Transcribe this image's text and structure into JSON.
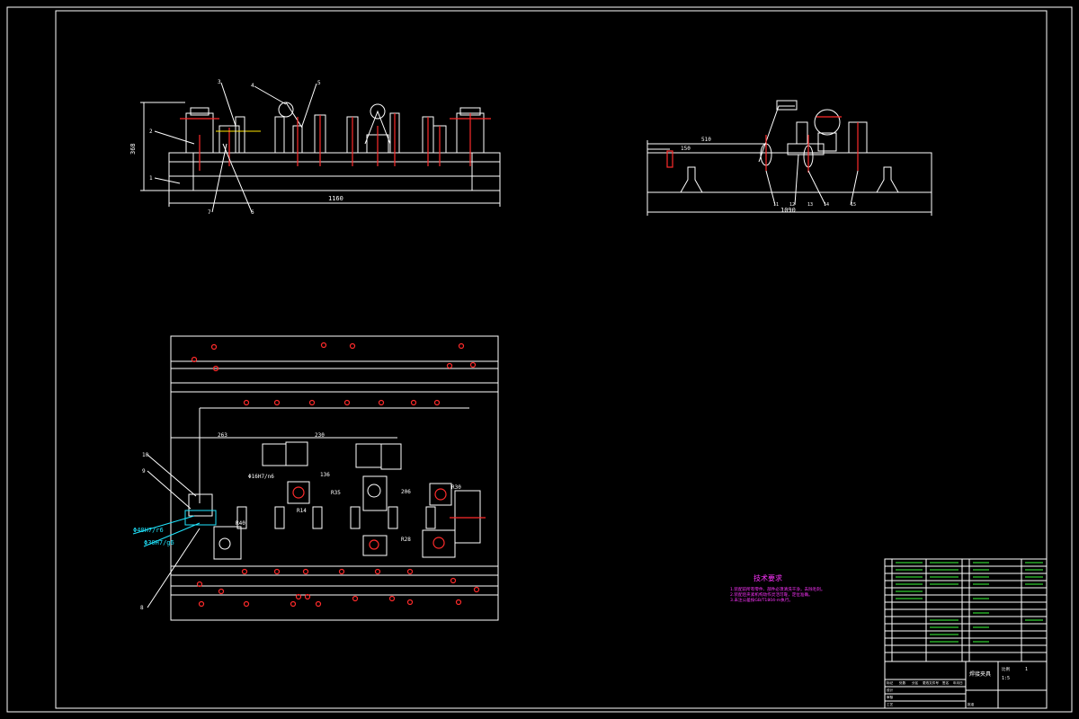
{
  "front_view": {
    "dim_height": "368",
    "dim_length": "1160",
    "callouts": [
      "1",
      "2",
      "3",
      "4",
      "5",
      "6",
      "7"
    ]
  },
  "side_view": {
    "dim_top": "510",
    "dim_small": "150",
    "dim_length": "1090",
    "callouts": [
      "11",
      "12",
      "13",
      "14",
      "15"
    ]
  },
  "plan_view": {
    "callouts": [
      "8",
      "9",
      "10"
    ],
    "fit_1": "Φ40H7/r6",
    "fit_2": "Φ30H7/g6",
    "fit_3": "Φ16H7/n6",
    "dim_a": "263",
    "dim_b": "230",
    "dim_c": "R35",
    "dim_d": "R28",
    "dim_e": "R30",
    "dim_f": "206",
    "dim_g": "R14",
    "dim_h": "R40",
    "dim_i": "136"
  },
  "tech_req": {
    "title": "技术要求",
    "lines": [
      "1.装配前所有零件、部件必须清洗干净，去除毛刺。",
      "2.装配后夹紧机构动作灵活可靠，定位准确。",
      "3.未注公差按GB/T1804-m执行。"
    ]
  },
  "title_block": {
    "drawing_title": "焊接夹具",
    "scale_label": "比例",
    "scale": "1:5",
    "sheet": "1",
    "labels": [
      "标记",
      "处数",
      "分区",
      "更改文件号",
      "签名",
      "年月日",
      "设计",
      "审核",
      "工艺",
      "批准"
    ]
  }
}
